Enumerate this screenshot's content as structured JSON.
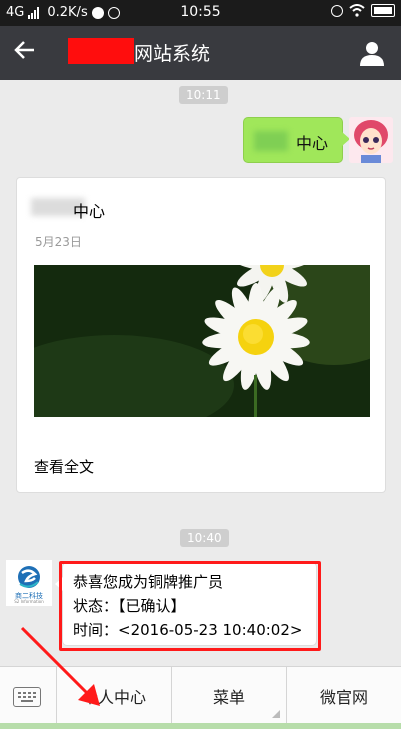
{
  "status_bar": {
    "network": "4G",
    "speed": "0.2K/s",
    "time": "10:55"
  },
  "header": {
    "back_icon": "back-arrow-icon",
    "title": "网站系统",
    "profile_icon": "person-icon"
  },
  "chat": {
    "timestamp1": "10:11",
    "outgoing_text": "中心",
    "card": {
      "title": "中心",
      "date": "5月23日",
      "read_more": "查看全文"
    },
    "timestamp2": "10:40",
    "incoming_lines": [
      "恭喜您成为铜牌推广员",
      "状态：【已确认】",
      "时间：<2016-05-23 10:40:02>"
    ],
    "logo_text": "商二科技",
    "logo_subtext": "S2 Information"
  },
  "menu": {
    "items": [
      "个人中心",
      "菜单",
      "微官网"
    ]
  },
  "colors": {
    "header_bg": "#393a3f",
    "bubble_out": "#a0e75a",
    "annotation_red": "#ff1a1a"
  }
}
